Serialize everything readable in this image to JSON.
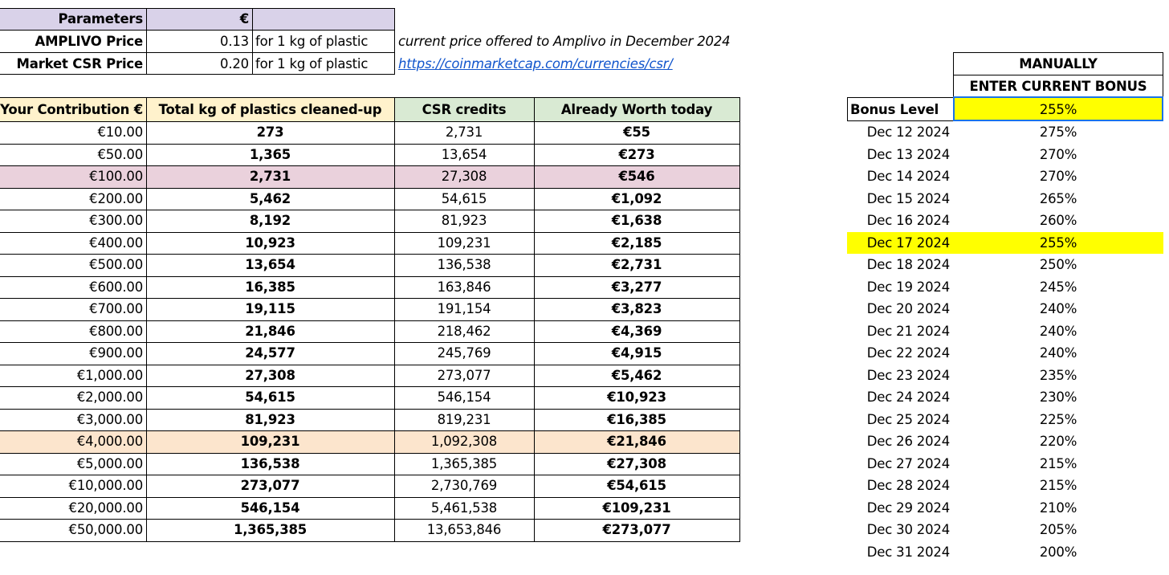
{
  "parameters": {
    "header_label": "Parameters",
    "header_currency": "€",
    "amplivo_label": "AMPLIVO Price",
    "amplivo_value": "0.13",
    "amplivo_unit": "for 1 kg of plastic",
    "amplivo_note": "current price offered to Amplivo in December 2024",
    "market_label": "Market CSR Price",
    "market_value": "0.20",
    "market_unit": "for 1 kg of plastic",
    "market_link": "https://coinmarketcap.com/currencies/csr/"
  },
  "main_table": {
    "headers": [
      "Your Contribution €",
      "Total kg of plastics cleaned-up",
      "CSR credits",
      "Already Worth today"
    ],
    "rows": [
      [
        "€10.00",
        "273",
        "2,731",
        "€55"
      ],
      [
        "€50.00",
        "1,365",
        "13,654",
        "€273"
      ],
      [
        "€100.00",
        "2,731",
        "27,308",
        "€546"
      ],
      [
        "€200.00",
        "5,462",
        "54,615",
        "€1,092"
      ],
      [
        "€300.00",
        "8,192",
        "81,923",
        "€1,638"
      ],
      [
        "€400.00",
        "10,923",
        "109,231",
        "€2,185"
      ],
      [
        "€500.00",
        "13,654",
        "136,538",
        "€2,731"
      ],
      [
        "€600.00",
        "16,385",
        "163,846",
        "€3,277"
      ],
      [
        "€700.00",
        "19,115",
        "191,154",
        "€3,823"
      ],
      [
        "€800.00",
        "21,846",
        "218,462",
        "€4,369"
      ],
      [
        "€900.00",
        "24,577",
        "245,769",
        "€4,915"
      ],
      [
        "€1,000.00",
        "27,308",
        "273,077",
        "€5,462"
      ],
      [
        "€2,000.00",
        "54,615",
        "546,154",
        "€10,923"
      ],
      [
        "€3,000.00",
        "81,923",
        "819,231",
        "€16,385"
      ],
      [
        "€4,000.00",
        "109,231",
        "1,092,308",
        "€21,846"
      ],
      [
        "€5,000.00",
        "136,538",
        "1,365,385",
        "€27,308"
      ],
      [
        "€10,000.00",
        "273,077",
        "2,730,769",
        "€54,615"
      ],
      [
        "€20,000.00",
        "546,154",
        "5,461,538",
        "€109,231"
      ],
      [
        "€50,000.00",
        "1,365,385",
        "13,653,846",
        "€273,077"
      ]
    ],
    "highlight_purple_row": 2,
    "highlight_orange_row": 14
  },
  "bonus": {
    "manual_line1": "MANUALLY",
    "manual_line2": "ENTER CURRENT BONUS",
    "level_label": "Bonus Level",
    "level_value": "255%",
    "schedule": [
      [
        "Dec 12 2024",
        "275%"
      ],
      [
        "Dec 13 2024",
        "270%"
      ],
      [
        "Dec 14 2024",
        "270%"
      ],
      [
        "Dec 15 2024",
        "265%"
      ],
      [
        "Dec 16 2024",
        "260%"
      ],
      [
        "Dec 17 2024",
        "255%"
      ],
      [
        "Dec 18 2024",
        "250%"
      ],
      [
        "Dec 19 2024",
        "245%"
      ],
      [
        "Dec 20 2024",
        "240%"
      ],
      [
        "Dec 21 2024",
        "240%"
      ],
      [
        "Dec 22 2024",
        "240%"
      ],
      [
        "Dec 23 2024",
        "235%"
      ],
      [
        "Dec 24 2024",
        "230%"
      ],
      [
        "Dec 25 2024",
        "225%"
      ],
      [
        "Dec 26 2024",
        "220%"
      ],
      [
        "Dec 27 2024",
        "215%"
      ],
      [
        "Dec 28 2024",
        "215%"
      ],
      [
        "Dec 29 2024",
        "210%"
      ],
      [
        "Dec 30 2024",
        "205%"
      ],
      [
        "Dec 31 2024",
        "200%"
      ]
    ],
    "highlight_row": 5
  },
  "colors": {
    "header_purple": "#d9d2e9",
    "contribution_header": "#fff2cc",
    "kg_header": "#fff2cc",
    "green_header": "#d9ead3",
    "row_purple": "#ead1dc",
    "row_orange": "#fce5cd",
    "yellow": "#ffff00",
    "link_blue": "#1155cc",
    "selection_blue": "#1a73e8"
  }
}
